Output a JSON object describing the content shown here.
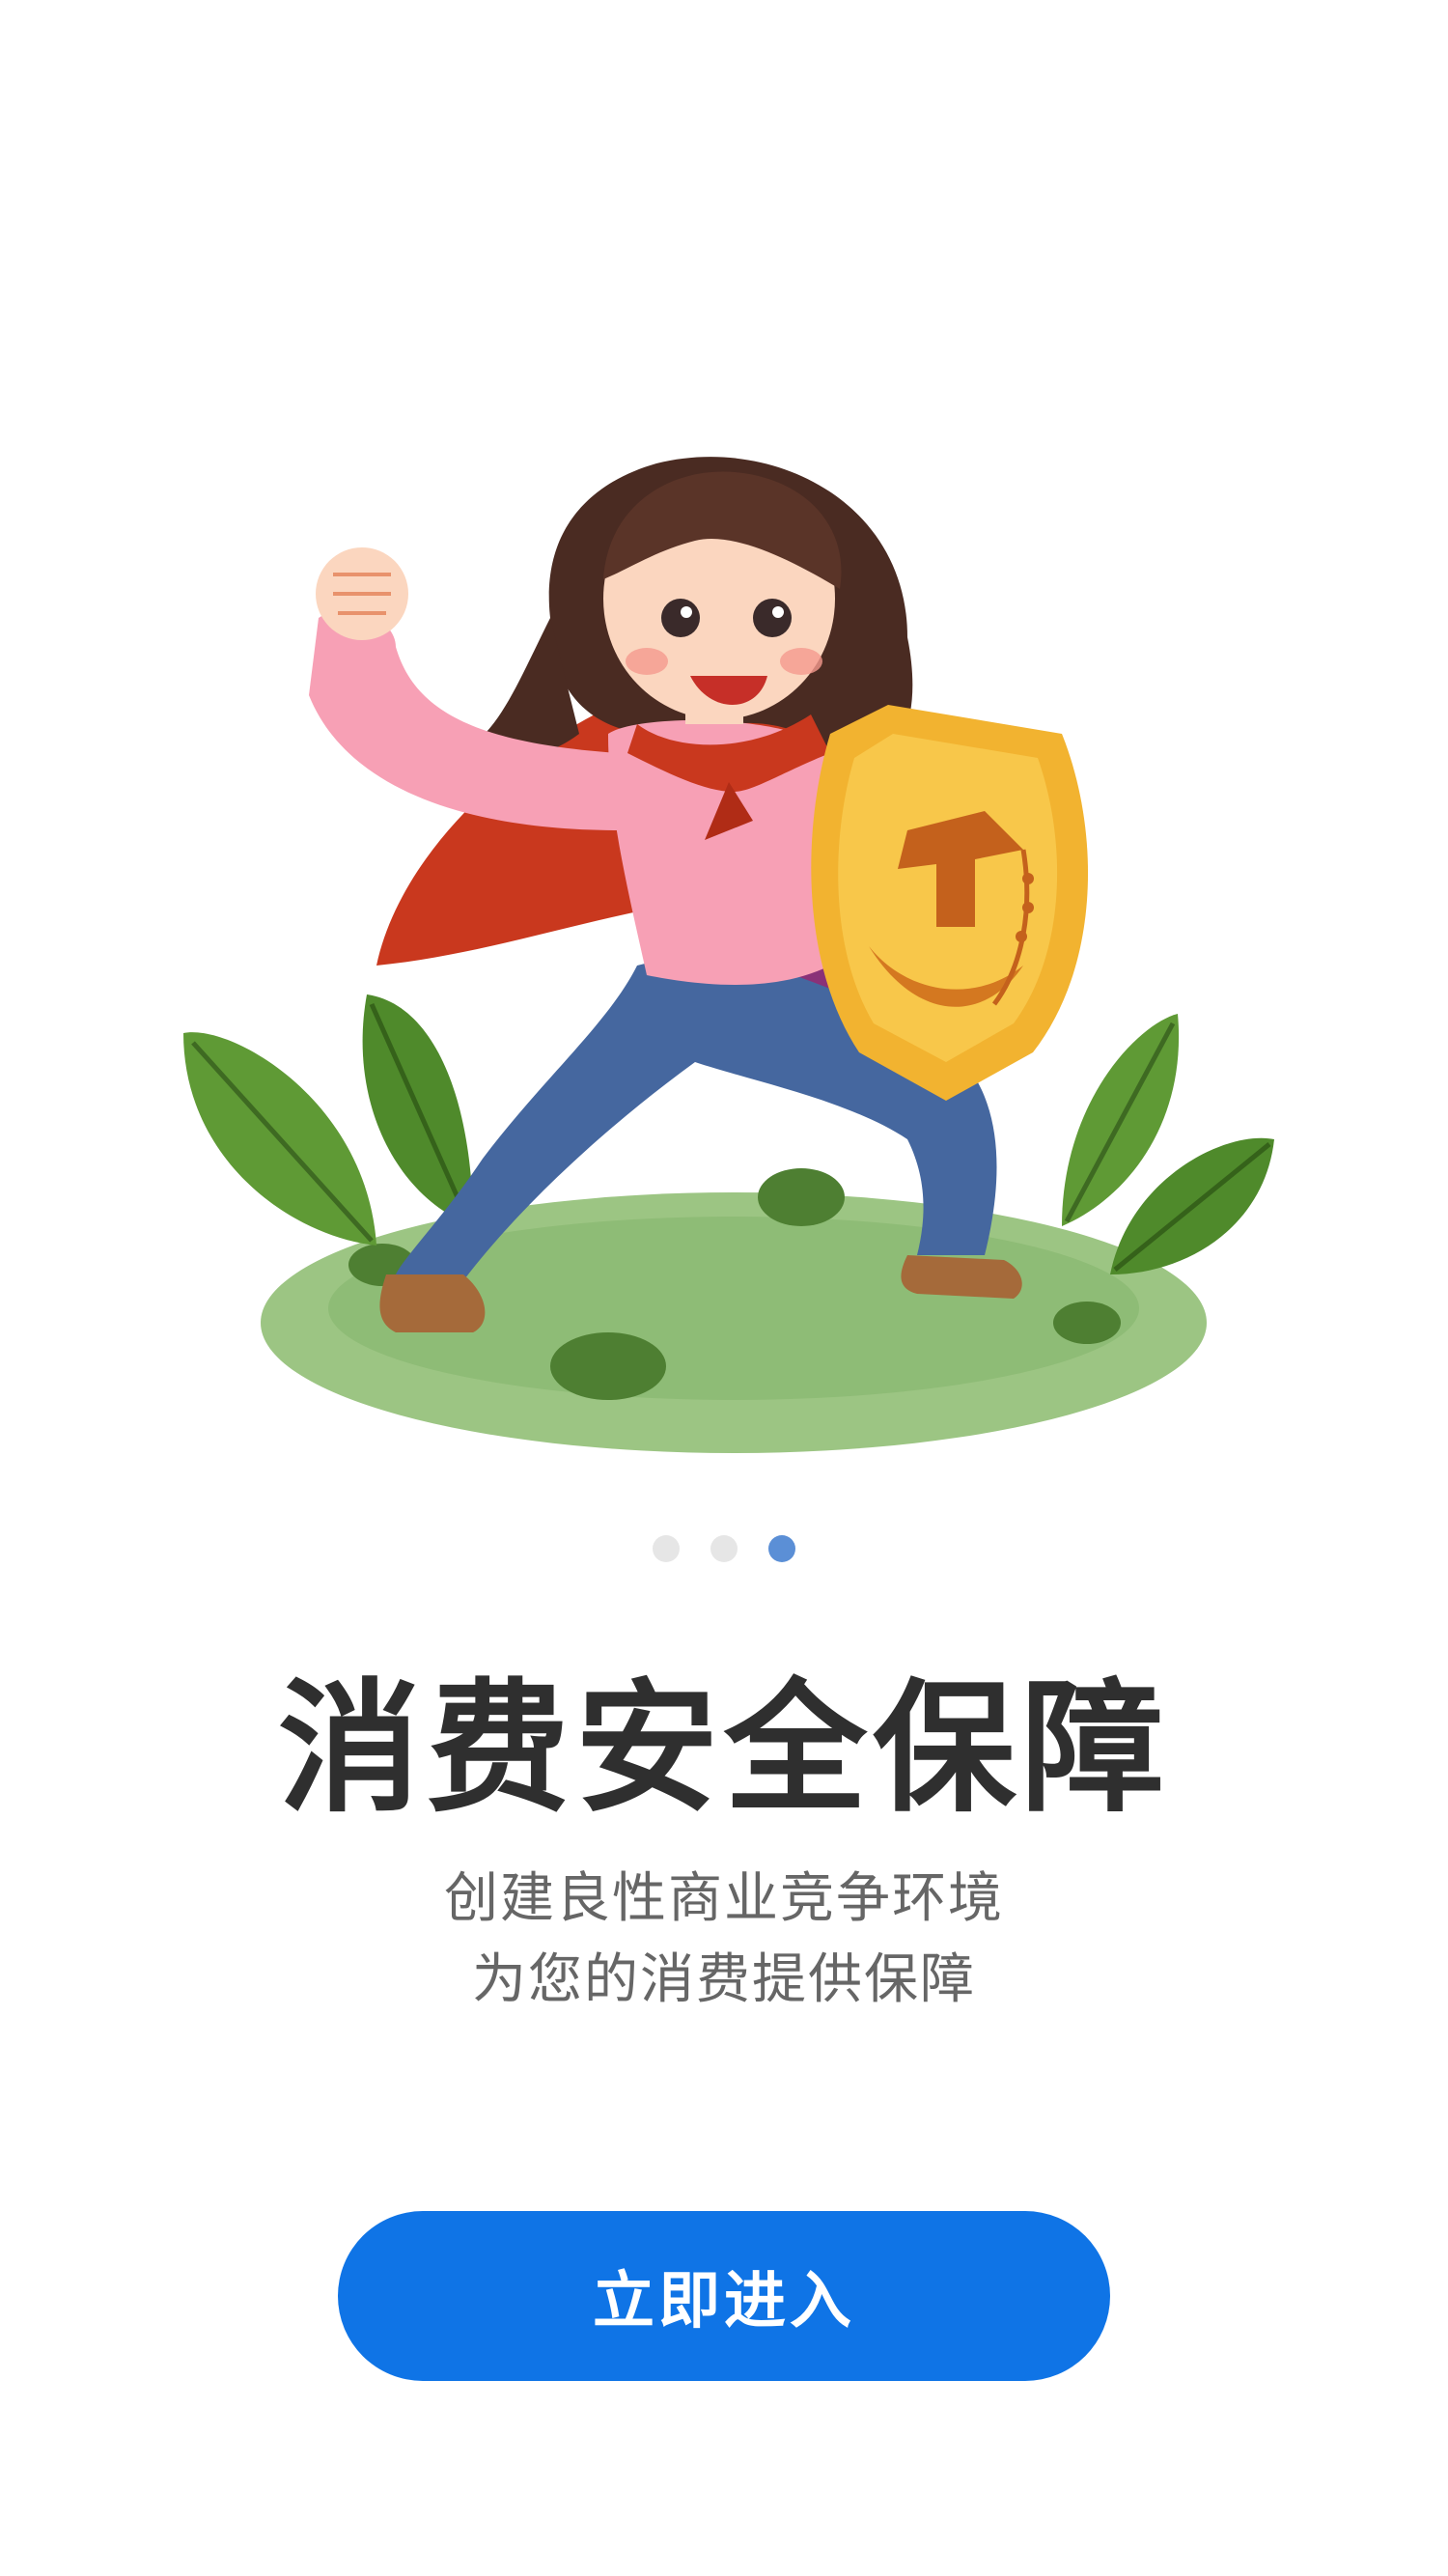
{
  "illustration": {
    "subject": "superhero-girl-with-shield",
    "icon_name": "shield-icon"
  },
  "pager": {
    "total": 3,
    "active_index": 2
  },
  "headline": "消费安全保障",
  "subtitle": {
    "line1": "创建良性商业竞争环境",
    "line2": "为您的消费提供保障"
  },
  "enter_button": {
    "label": "立即进入",
    "color": "#0f74e6"
  },
  "colors": {
    "dot_inactive": "#e6e6e6",
    "dot_active": "#5b8fd6",
    "headline": "#2f2f2f",
    "subtitle": "#666666"
  }
}
